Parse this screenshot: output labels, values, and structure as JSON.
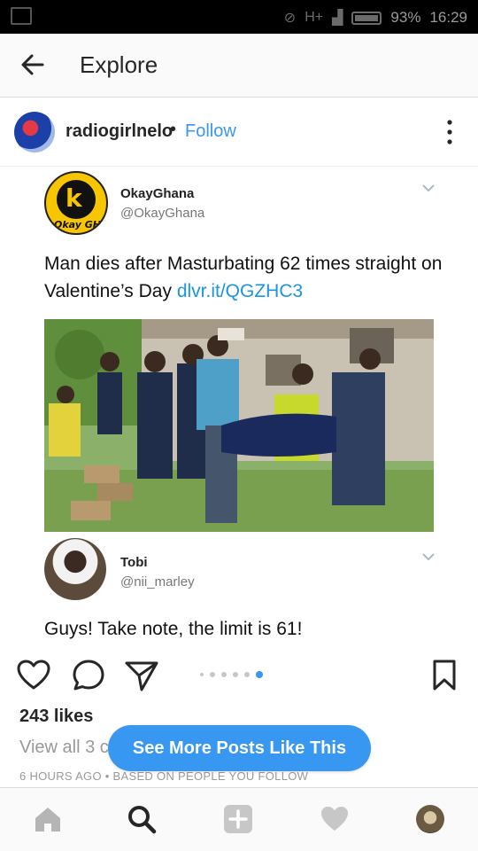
{
  "status_bar": {
    "network": "H+",
    "battery": "93%",
    "time": "16:29"
  },
  "header": {
    "title": "Explore",
    "back_icon": "arrow-left-icon"
  },
  "post": {
    "username": "radiogirlnelo",
    "separator": "•",
    "follow_label": "Follow",
    "more_icon": "more-vertical-icon"
  },
  "tweet": {
    "name": "OkayGhana",
    "handle": "@OkayGhana",
    "logo_text": "Okay GH",
    "text": "Man dies after Masturbating 62 times straight on Valentine’s Day ",
    "link": "dlvr.it/QGZHC3"
  },
  "reply": {
    "name": "Tobi",
    "handle": "@nii_marley",
    "text": "Guys! Take note, the limit is 61!"
  },
  "actions": {
    "like_icon": "heart-outline-icon",
    "comment_icon": "comment-icon",
    "share_icon": "send-icon",
    "save_icon": "bookmark-icon",
    "carousel_count": 6,
    "carousel_active_index": 5
  },
  "likes_text": "243 likes",
  "view_all_text": "View all 3 c",
  "meta_text": "6 HOURS AGO • BASED ON PEOPLE YOU FOLLOW",
  "see_more_label": "See More Posts Like This",
  "colors": {
    "accent": "#3897f0",
    "twitter_link": "#1b95e0",
    "okay_yellow": "#f7c600"
  },
  "bottom_nav": [
    {
      "name": "home-icon"
    },
    {
      "name": "search-icon"
    },
    {
      "name": "add-post-icon"
    },
    {
      "name": "activity-heart-icon"
    },
    {
      "name": "profile-avatar"
    }
  ]
}
